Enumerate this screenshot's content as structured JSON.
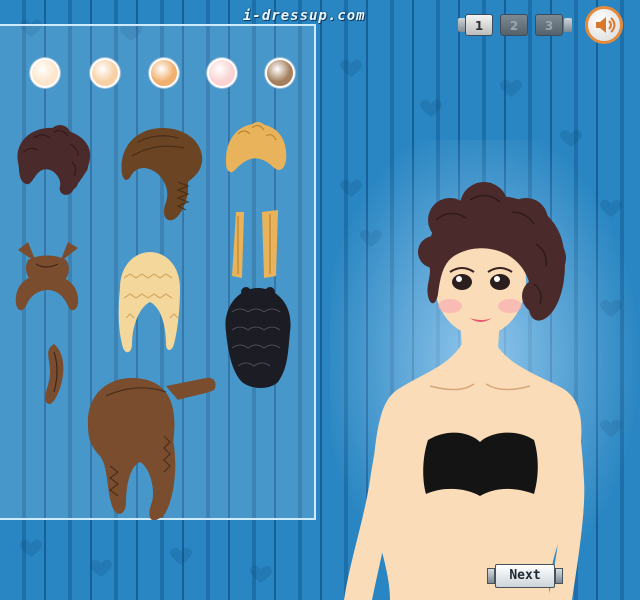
{
  "brand": {
    "text": "i-dressup.com"
  },
  "pager": {
    "pages": [
      {
        "label": "1",
        "active": true
      },
      {
        "label": "2",
        "active": false
      },
      {
        "label": "3",
        "active": false
      }
    ]
  },
  "sound": {
    "icon": "speaker-icon"
  },
  "skin_tones": [
    "#fde6cc",
    "#f7d0a6",
    "#f1b06e",
    "#fbd3d3",
    "#a5805e"
  ],
  "hair_colors": {
    "dark_brown": "#4a2a2a",
    "brown": "#6b4424",
    "blonde": "#e8b35a",
    "light_blonde": "#f4d79b",
    "black": "#1c1c24",
    "walnut": "#7a4d2e"
  },
  "next_button": {
    "label": "Next"
  }
}
